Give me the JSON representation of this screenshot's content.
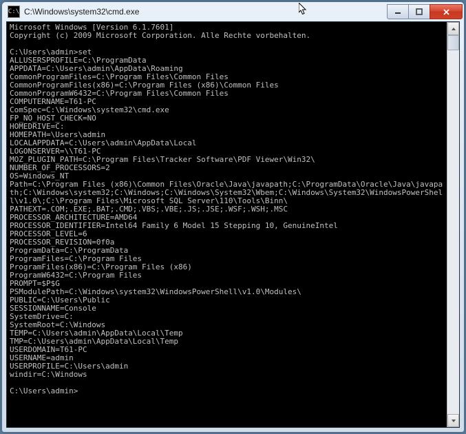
{
  "window": {
    "title": "C:\\Windows\\system32\\cmd.exe",
    "icon_name": "cmd-icon",
    "icon_glyph": "C:\\"
  },
  "terminal": {
    "header": [
      "Microsoft Windows [Version 6.1.7601]",
      "Copyright (c) 2009 Microsoft Corporation. Alle Rechte vorbehalten.",
      ""
    ],
    "prompt1": "C:\\Users\\admin>set",
    "env": [
      "ALLUSERSPROFILE=C:\\ProgramData",
      "APPDATA=C:\\Users\\admin\\AppData\\Roaming",
      "CommonProgramFiles=C:\\Program Files\\Common Files",
      "CommonProgramFiles(x86)=C:\\Program Files (x86)\\Common Files",
      "CommonProgramW6432=C:\\Program Files\\Common Files",
      "COMPUTERNAME=T61-PC",
      "ComSpec=C:\\Windows\\system32\\cmd.exe",
      "FP_NO_HOST_CHECK=NO",
      "HOMEDRIVE=C:",
      "HOMEPATH=\\Users\\admin",
      "LOCALAPPDATA=C:\\Users\\admin\\AppData\\Local",
      "LOGONSERVER=\\\\T61-PC",
      "MOZ_PLUGIN_PATH=C:\\Program Files\\Tracker Software\\PDF Viewer\\Win32\\",
      "NUMBER_OF_PROCESSORS=2",
      "OS=Windows_NT",
      "Path=C:\\Program Files (x86)\\Common Files\\Oracle\\Java\\javapath;C:\\ProgramData\\Oracle\\Java\\javapath;C:\\Windows\\system32;C:\\Windows;C:\\Windows\\System32\\Wbem;C:\\Windows\\System32\\WindowsPowerShell\\v1.0\\;C:\\Program Files\\Microsoft SQL Server\\110\\Tools\\Binn\\",
      "PATHEXT=.COM;.EXE;.BAT;.CMD;.VBS;.VBE;.JS;.JSE;.WSF;.WSH;.MSC",
      "PROCESSOR_ARCHITECTURE=AMD64",
      "PROCESSOR_IDENTIFIER=Intel64 Family 6 Model 15 Stepping 10, GenuineIntel",
      "PROCESSOR_LEVEL=6",
      "PROCESSOR_REVISION=0f0a",
      "ProgramData=C:\\ProgramData",
      "ProgramFiles=C:\\Program Files",
      "ProgramFiles(x86)=C:\\Program Files (x86)",
      "ProgramW6432=C:\\Program Files",
      "PROMPT=$P$G",
      "PSModulePath=C:\\Windows\\system32\\WindowsPowerShell\\v1.0\\Modules\\",
      "PUBLIC=C:\\Users\\Public",
      "SESSIONNAME=Console",
      "SystemDrive=C:",
      "SystemRoot=C:\\Windows",
      "TEMP=C:\\Users\\admin\\AppData\\Local\\Temp",
      "TMP=C:\\Users\\admin\\AppData\\Local\\Temp",
      "USERDOMAIN=T61-PC",
      "USERNAME=admin",
      "USERPROFILE=C:\\Users\\admin",
      "windir=C:\\Windows"
    ],
    "prompt2": "C:\\Users\\admin>"
  },
  "controls": {
    "minimize": "minimize",
    "maximize": "maximize",
    "close": "close"
  }
}
